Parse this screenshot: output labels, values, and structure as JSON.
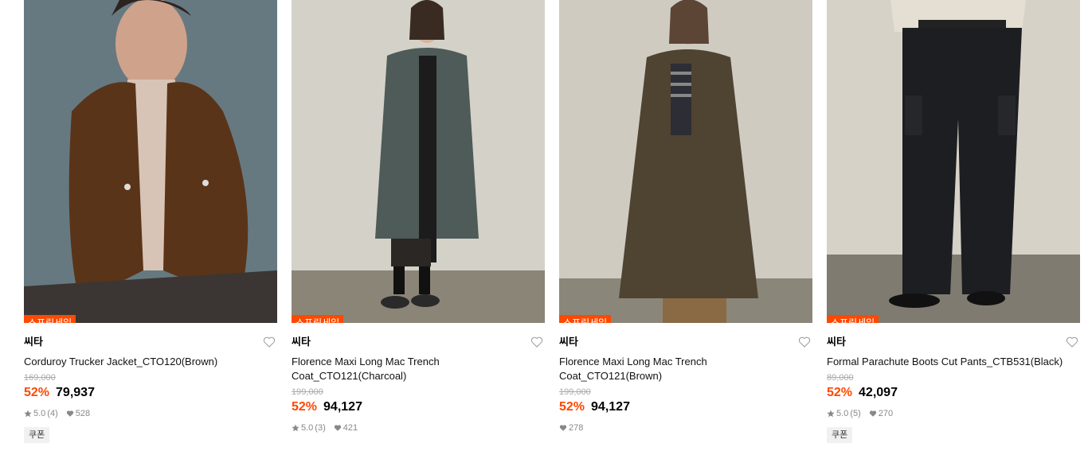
{
  "products": [
    {
      "badge": "스프링세일",
      "brand": "씨타",
      "name": "Corduroy Trucker Jacket_CTO120(Brown)",
      "original_price": "169,000",
      "discount": "52%",
      "price": "79,937",
      "rating": "5.0",
      "reviews": "(4)",
      "likes": "528",
      "coupon": "쿠폰",
      "photo": "model-in-brown-corduroy-jacket"
    },
    {
      "badge": "스프링세일",
      "brand": "씨타",
      "name": "Florence Maxi Long Mac Trench Coat_CTO121(Charcoal)",
      "original_price": "199,000",
      "discount": "52%",
      "price": "94,127",
      "rating": "5.0",
      "reviews": "(3)",
      "likes": "421",
      "coupon": "",
      "photo": "model-in-charcoal-long-coat"
    },
    {
      "badge": "스프링세일",
      "brand": "씨타",
      "name": "Florence Maxi Long Mac Trench Coat_CTO121(Brown)",
      "original_price": "199,000",
      "discount": "52%",
      "price": "94,127",
      "rating": "",
      "reviews": "",
      "likes": "278",
      "coupon": "",
      "photo": "model-in-brown-long-coat"
    },
    {
      "badge": "스프링세일",
      "brand": "씨타",
      "name": "Formal Parachute Boots Cut Pants_CTB531(Black)",
      "original_price": "89,000",
      "discount": "52%",
      "price": "42,097",
      "rating": "5.0",
      "reviews": "(5)",
      "likes": "270",
      "coupon": "쿠폰",
      "photo": "model-in-black-cargo-pants"
    }
  ],
  "colors": {
    "accent": "#ff4800",
    "muted": "#888888",
    "strike": "#aaaaaa"
  }
}
